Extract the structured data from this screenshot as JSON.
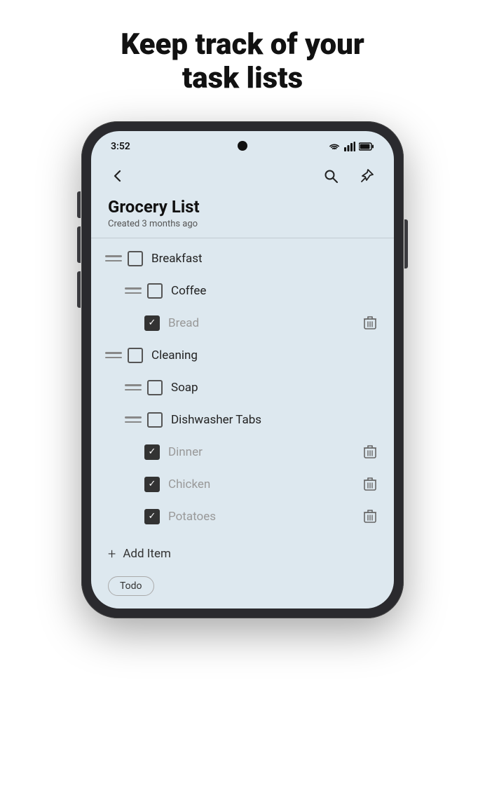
{
  "page": {
    "headline_line1": "Keep track of your",
    "headline_line2": "task lists"
  },
  "status_bar": {
    "time": "3:52"
  },
  "app_bar": {
    "back_label": "←",
    "search_label": "search",
    "pin_label": "pin"
  },
  "list": {
    "title": "Grocery List",
    "subtitle": "Created 3 months ago"
  },
  "tasks": [
    {
      "id": "breakfast",
      "label": "Breakfast",
      "checked": false,
      "indent": 0,
      "show_delete": false
    },
    {
      "id": "coffee",
      "label": "Coffee",
      "checked": false,
      "indent": 1,
      "show_delete": false
    },
    {
      "id": "bread",
      "label": "Bread",
      "checked": true,
      "indent": 2,
      "show_delete": true
    },
    {
      "id": "cleaning",
      "label": "Cleaning",
      "checked": false,
      "indent": 0,
      "show_delete": false
    },
    {
      "id": "soap",
      "label": "Soap",
      "checked": false,
      "indent": 1,
      "show_delete": false
    },
    {
      "id": "dishwasher",
      "label": "Dishwasher Tabs",
      "checked": false,
      "indent": 1,
      "show_delete": false
    },
    {
      "id": "dinner",
      "label": "Dinner",
      "checked": true,
      "indent": 2,
      "show_delete": true
    },
    {
      "id": "chicken",
      "label": "Chicken",
      "checked": true,
      "indent": 2,
      "show_delete": true
    },
    {
      "id": "potatoes",
      "label": "Potatoes",
      "checked": true,
      "indent": 2,
      "show_delete": true
    }
  ],
  "add_item": {
    "label": "Add Item"
  },
  "bottom_pill": {
    "label": "Todo"
  }
}
